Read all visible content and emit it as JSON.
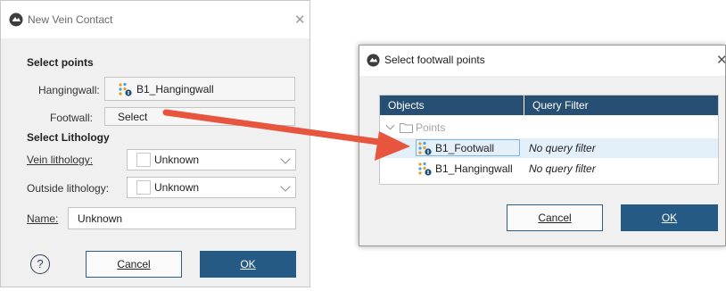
{
  "dialog1": {
    "title": "New Vein Contact",
    "section_points": "Select points",
    "hangingwall_label": "Hangingwall:",
    "hangingwall_value": "B1_Hangingwall",
    "footwall_label": "Footwall:",
    "footwall_button": "Select",
    "section_lithology": "Select Lithology",
    "vein_label": "Vein lithology:",
    "vein_value": "Unknown",
    "outside_label": "Outside lithology:",
    "outside_value": "Unknown",
    "name_label": "Name:",
    "name_value": "Unknown",
    "help_glyph": "?",
    "cancel": "Cancel",
    "ok": "OK"
  },
  "dialog2": {
    "title": "Select footwall points",
    "columns": [
      "Objects",
      "Query Filter"
    ],
    "folder": "Points",
    "rows": [
      {
        "name": "B1_Footwall",
        "filter": "No query filter",
        "selected": true
      },
      {
        "name": "B1_Hangingwall",
        "filter": "No query filter",
        "selected": false
      }
    ],
    "cancel": "Cancel",
    "ok": "OK"
  },
  "colors": {
    "arrow": "#e8553f",
    "header": "#264f73",
    "ok_button": "#255a85",
    "selected_row": "#e3f0fa"
  },
  "icons": [
    "app-icon",
    "close-icon",
    "points-icon",
    "chevron-down-icon",
    "folder-icon",
    "help-icon",
    "arrow-annotation"
  ]
}
